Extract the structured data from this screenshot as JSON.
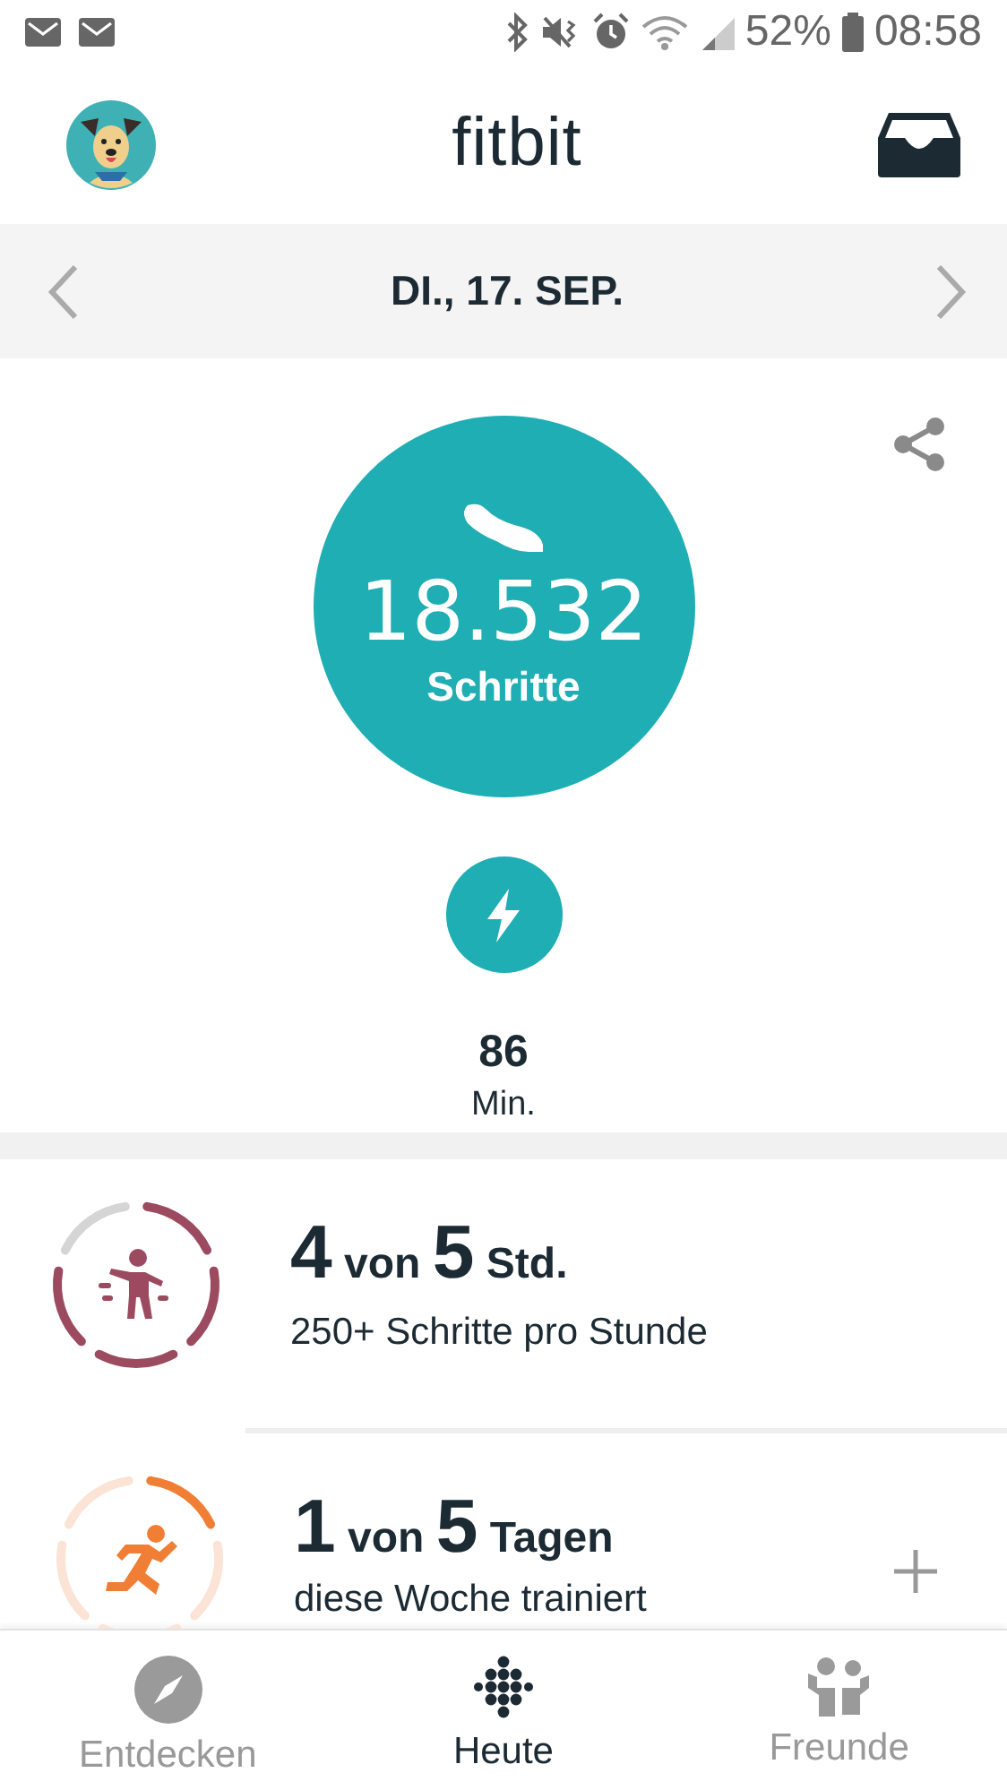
{
  "status_bar": {
    "battery": "52%",
    "time": "08:58"
  },
  "header": {
    "title": "fitbit"
  },
  "date_bar": {
    "date": "DI., 17. SEP."
  },
  "steps": {
    "value": "18.532",
    "label": "Schritte"
  },
  "active_minutes": {
    "value": "86",
    "unit": "Min."
  },
  "goals": [
    {
      "kind": "hourly",
      "value": "4",
      "of": "von",
      "goal": "5",
      "unit": "Std.",
      "subtitle": "250+ Schritte pro Stunde",
      "color": "#9c4a5f",
      "add": false
    },
    {
      "kind": "exercise",
      "value": "1",
      "of": "von",
      "goal": "5",
      "unit": "Tagen",
      "subtitle": "diese Woche trainiert",
      "color": "#f07f35",
      "add": true
    }
  ],
  "bottom_nav": [
    {
      "kind": "discover",
      "label": "Entdecken",
      "selected": false
    },
    {
      "kind": "today",
      "label": "Heute",
      "selected": true
    },
    {
      "kind": "friends",
      "label": "Freunde",
      "selected": false
    }
  ]
}
